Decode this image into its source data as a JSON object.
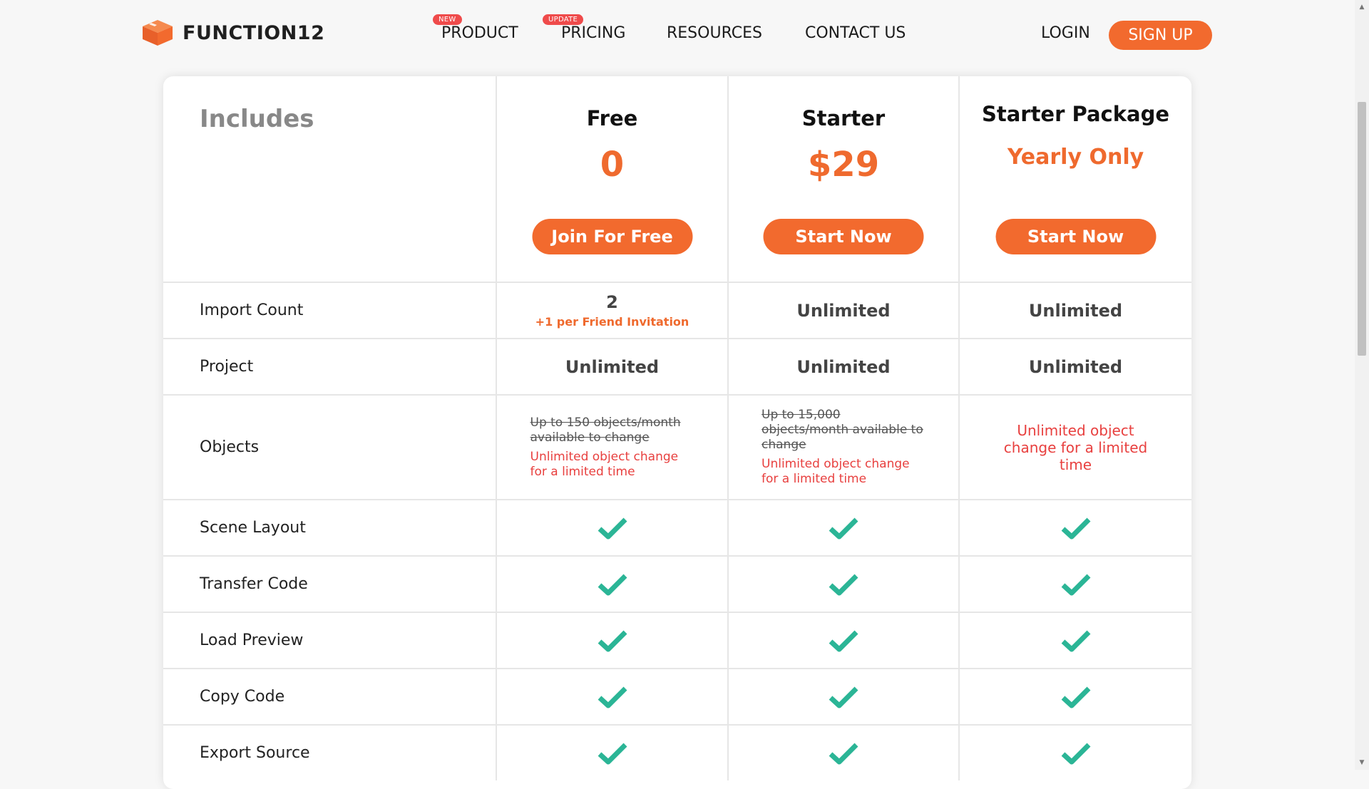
{
  "header": {
    "logo_text": "FUNCTION12",
    "nav": [
      {
        "label": "PRODUCT",
        "badge": "NEW"
      },
      {
        "label": "PRICING",
        "badge": "UPDATE"
      },
      {
        "label": "RESOURCES",
        "badge": null
      },
      {
        "label": "CONTACT US",
        "badge": null
      }
    ],
    "login": "LOGIN",
    "signup": "SIGN UP"
  },
  "colors": {
    "accent": "#f26a2e",
    "badge": "#ef4b4b",
    "check": "#2bb596",
    "red_text": "#e8403f"
  },
  "table": {
    "includes_label": "Includes",
    "plans": [
      {
        "name": "Free",
        "price": "0",
        "button": "Join For Free"
      },
      {
        "name": "Starter",
        "price": "$29",
        "button": "Start Now"
      },
      {
        "name": "Starter Package",
        "price": "Yearly Only",
        "button": "Start Now"
      }
    ],
    "rows": {
      "import_count": {
        "label": "Import Count",
        "free_value": "2",
        "free_sub": "+1 per Friend Invitation",
        "starter": "Unlimited",
        "package": "Unlimited"
      },
      "project": {
        "label": "Project",
        "free": "Unlimited",
        "starter": "Unlimited",
        "package": "Unlimited"
      },
      "objects": {
        "label": "Objects",
        "free_struck": "Up to 150 objects/month available to change",
        "free_note": "Unlimited object change for a limited time",
        "starter_struck": "Up to 15,000 objects/month available to change",
        "starter_note": "Unlimited object change for a limited time",
        "package_note": "Unlimited object change for a limited time"
      },
      "features": [
        {
          "label": "Scene Layout",
          "icon": "check-icon"
        },
        {
          "label": "Transfer Code",
          "icon": "check-icon"
        },
        {
          "label": "Load Preview",
          "icon": "check-icon"
        },
        {
          "label": "Copy Code",
          "icon": "check-icon"
        },
        {
          "label": "Export Source",
          "icon": "check-icon"
        }
      ]
    }
  }
}
